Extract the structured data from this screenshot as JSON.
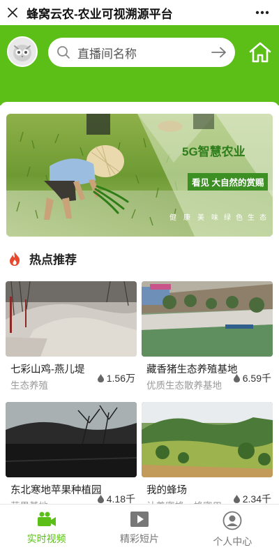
{
  "window": {
    "title": "蜂窝云农-农业可视溯源平台"
  },
  "search": {
    "placeholder": "直播间名称"
  },
  "banner": {
    "headline": "5G智慧农业",
    "tagline": "看见 大自然的赏赐",
    "words_left": [
      "健",
      "康",
      "美",
      "味"
    ],
    "words_right": [
      "绿",
      "色",
      "生",
      "态"
    ]
  },
  "hot": {
    "title": "热点推荐"
  },
  "cards": [
    {
      "name": "七彩山鸡-燕儿堤",
      "sub": "生态养殖",
      "views": "1.56万"
    },
    {
      "name": "藏香猪生态养殖基地",
      "sub": "优质生态散养基地",
      "views": "6.59千"
    },
    {
      "name": "东北寒地苹果种植园",
      "sub": "苹果基地",
      "views": "4.18千"
    },
    {
      "name": "我的蜂场",
      "sub": "认养蜜蜂、蜂蜜用",
      "views": "2.34千"
    }
  ],
  "tabs": [
    {
      "label": "实时视频",
      "icon": "video-camera-icon",
      "active": true
    },
    {
      "label": "精彩短片",
      "icon": "play-icon",
      "active": false
    },
    {
      "label": "个人中心",
      "icon": "user-icon",
      "active": false
    }
  ],
  "colors": {
    "brand": "#5bbf18",
    "fire": "#e8482c"
  }
}
